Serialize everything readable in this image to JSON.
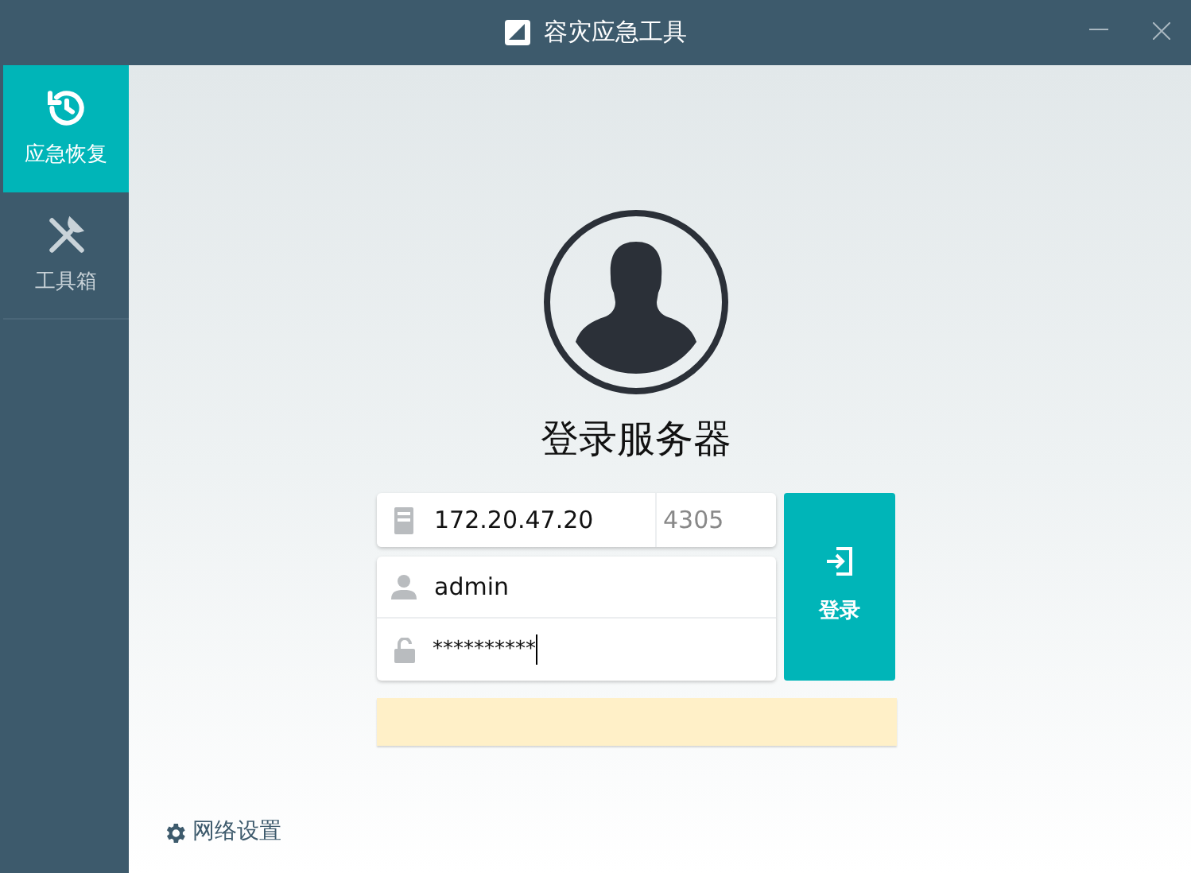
{
  "window": {
    "title": "容灾应急工具"
  },
  "sidebar": {
    "items": [
      {
        "label": "应急恢复",
        "kind": "restore",
        "selected": true
      },
      {
        "label": "工具箱",
        "kind": "tools",
        "selected": false
      }
    ]
  },
  "login": {
    "title": "登录服务器",
    "server": {
      "value": "172.20.47.20"
    },
    "port": {
      "placeholder": "4305"
    },
    "username": {
      "value": "admin"
    },
    "password": {
      "value": "**********"
    },
    "button": "登录"
  },
  "footer": {
    "network_settings": "网络设置"
  }
}
